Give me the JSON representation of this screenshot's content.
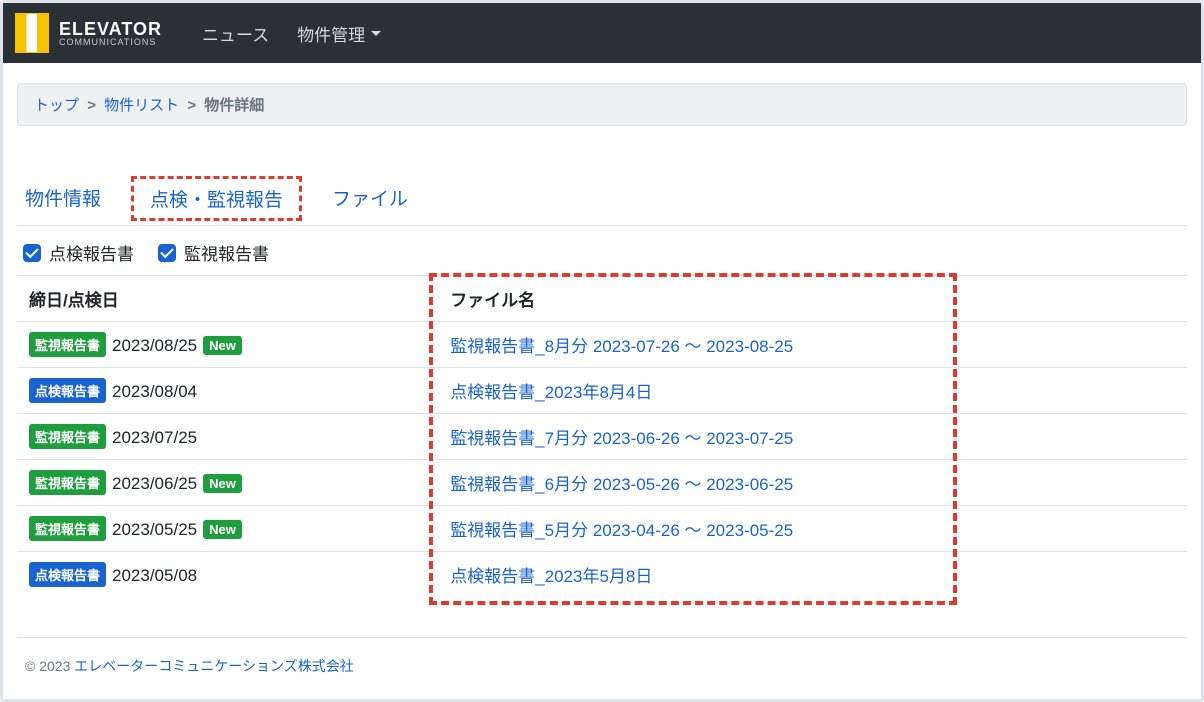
{
  "brand": {
    "line1": "ELEVATOR",
    "line2": "COMMUNICATIONS"
  },
  "nav": {
    "news": "ニュース",
    "property_mgmt": "物件管理"
  },
  "breadcrumb": {
    "top": "トップ",
    "sep": ">",
    "property_list": "物件リスト",
    "current": "物件詳細"
  },
  "tabs": {
    "info": "物件情報",
    "inspection_monitoring": "点検・監視報告",
    "files": "ファイル"
  },
  "filters": {
    "inspection_report": "点検報告書",
    "monitoring_report": "監視報告書"
  },
  "table": {
    "col_date": "締日/点検日",
    "col_file": "ファイル名",
    "new_label": "New",
    "labels": {
      "monitoring": "監視報告書",
      "inspection": "点検報告書"
    },
    "rows": [
      {
        "type": "monitoring",
        "date": "2023/08/25",
        "is_new": true,
        "file": "監視報告書_8月分 2023-07-26 〜 2023-08-25"
      },
      {
        "type": "inspection",
        "date": "2023/08/04",
        "is_new": false,
        "file": "点検報告書_2023年8月4日"
      },
      {
        "type": "monitoring",
        "date": "2023/07/25",
        "is_new": false,
        "file": "監視報告書_7月分 2023-06-26 〜 2023-07-25"
      },
      {
        "type": "monitoring",
        "date": "2023/06/25",
        "is_new": true,
        "file": "監視報告書_6月分 2023-05-26 〜 2023-06-25"
      },
      {
        "type": "monitoring",
        "date": "2023/05/25",
        "is_new": true,
        "file": "監視報告書_5月分 2023-04-26 〜 2023-05-25"
      },
      {
        "type": "inspection",
        "date": "2023/05/08",
        "is_new": false,
        "file": "点検報告書_2023年5月8日"
      }
    ]
  },
  "footer": {
    "copyright_prefix": "© 2023",
    "company_partial": "エレベーターコミュニケーションズ株式会社"
  }
}
